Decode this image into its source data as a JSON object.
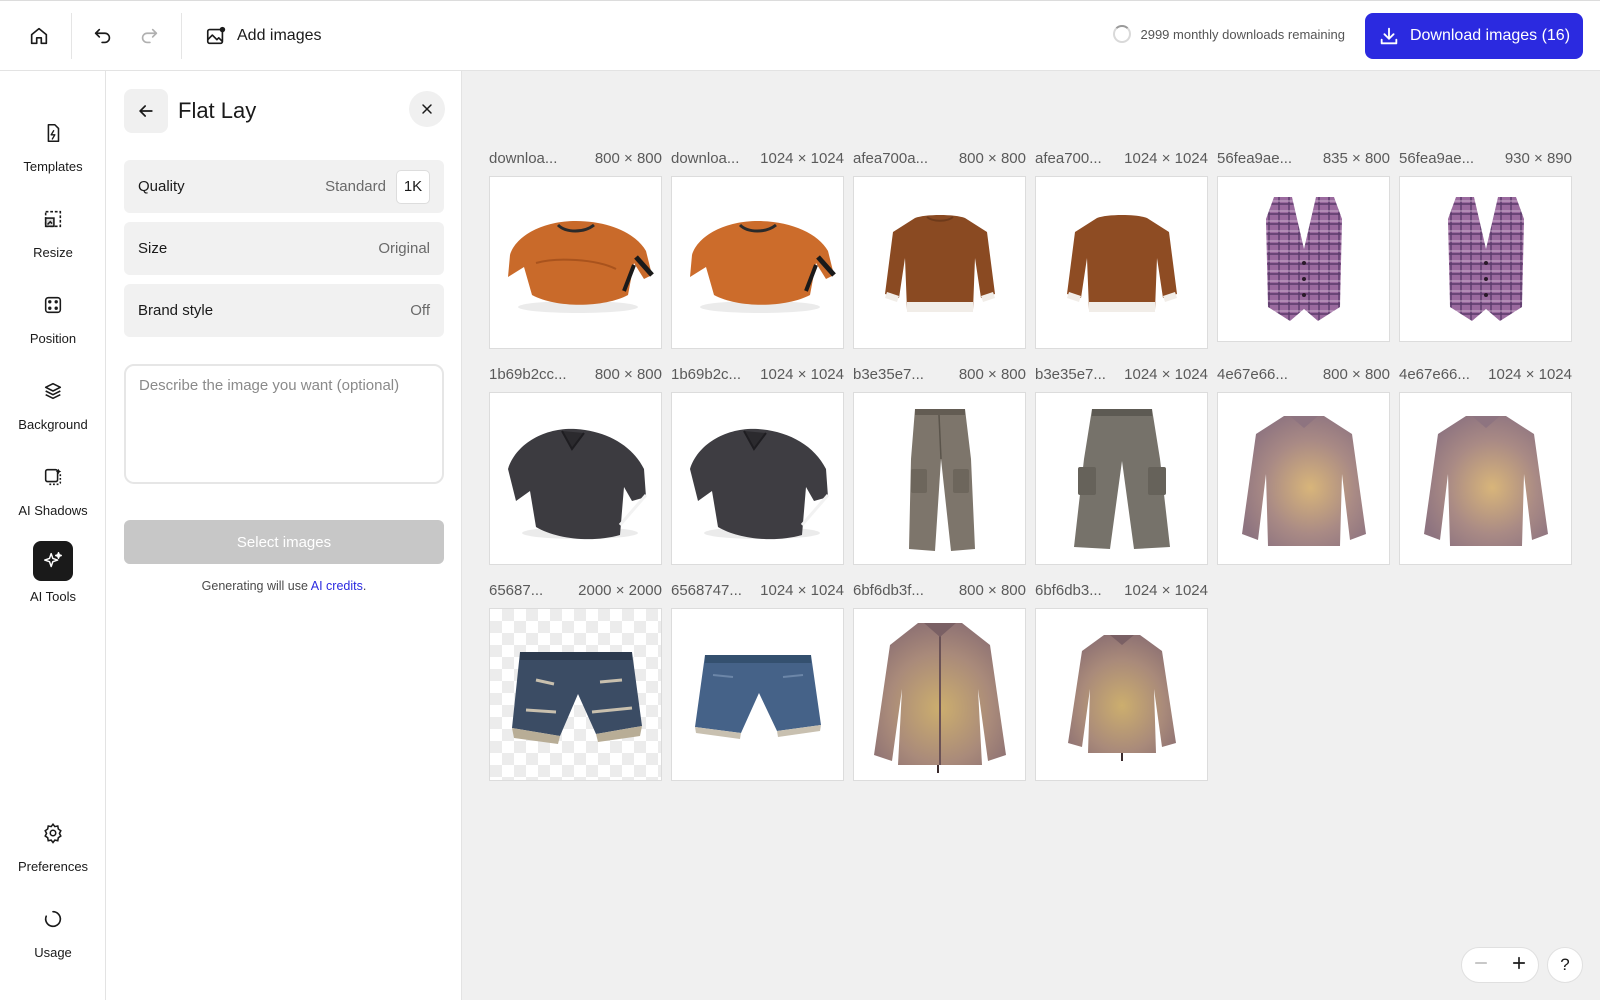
{
  "toolbar": {
    "add_images_label": "Add images",
    "remaining_text": "2999 monthly downloads remaining",
    "download_label": "Download images (16)"
  },
  "rail": {
    "items": [
      {
        "label": "Templates",
        "icon": "templates-icon"
      },
      {
        "label": "Resize",
        "icon": "resize-icon"
      },
      {
        "label": "Position",
        "icon": "position-icon"
      },
      {
        "label": "Background",
        "icon": "background-icon"
      },
      {
        "label": "AI Shadows",
        "icon": "ai-shadows-icon"
      },
      {
        "label": "AI Tools",
        "icon": "ai-tools-icon",
        "active": true
      },
      {
        "label": "Preferences",
        "icon": "gear-icon"
      },
      {
        "label": "Usage",
        "icon": "usage-icon"
      }
    ]
  },
  "panel": {
    "title": "Flat Lay",
    "quality": {
      "label": "Quality",
      "value": "Standard",
      "chip": "1K"
    },
    "size": {
      "label": "Size",
      "value": "Original"
    },
    "brand_style": {
      "label": "Brand style",
      "value": "Off"
    },
    "prompt_placeholder": "Describe the image you want (optional)",
    "select_label": "Select images",
    "credits_prefix": "Generating will use ",
    "credits_link": "AI credits",
    "credits_suffix": "."
  },
  "gallery": {
    "images": [
      {
        "name": "downloa...",
        "dims": "800 × 800",
        "item": "orange-sweater"
      },
      {
        "name": "downloa...",
        "dims": "1024 × 1024",
        "item": "orange-sweater"
      },
      {
        "name": "afea700a...",
        "dims": "800 × 800",
        "item": "brown-sweatshirt"
      },
      {
        "name": "afea700...",
        "dims": "1024 × 1024",
        "item": "brown-sweatshirt"
      },
      {
        "name": "56fea9ae...",
        "dims": "835 × 800",
        "item": "plaid-vest"
      },
      {
        "name": "56fea9ae...",
        "dims": "930 × 890",
        "item": "plaid-vest"
      },
      {
        "name": "1b69b2cc...",
        "dims": "800 × 800",
        "item": "grey-polo"
      },
      {
        "name": "1b69b2c...",
        "dims": "1024 × 1024",
        "item": "grey-polo"
      },
      {
        "name": "b3e35e7...",
        "dims": "800 × 800",
        "item": "cargo-pants"
      },
      {
        "name": "b3e35e7...",
        "dims": "1024 × 1024",
        "item": "cargo-pants"
      },
      {
        "name": "4e67e66...",
        "dims": "800 × 800",
        "item": "gradient-jacket"
      },
      {
        "name": "4e67e66...",
        "dims": "1024 × 1024",
        "item": "gradient-jacket"
      },
      {
        "name": "65687...",
        "dims": "2000 × 2000",
        "item": "denim-shorts"
      },
      {
        "name": "6568747...",
        "dims": "1024 × 1024",
        "item": "denim-shorts"
      },
      {
        "name": "6bf6db3f...",
        "dims": "800 × 800",
        "item": "gradient-jacket-open"
      },
      {
        "name": "6bf6db3...",
        "dims": "1024 × 1024",
        "item": "gradient-jacket-open"
      }
    ]
  },
  "colors": {
    "accent": "#2b2ae0"
  },
  "help_label": "?"
}
